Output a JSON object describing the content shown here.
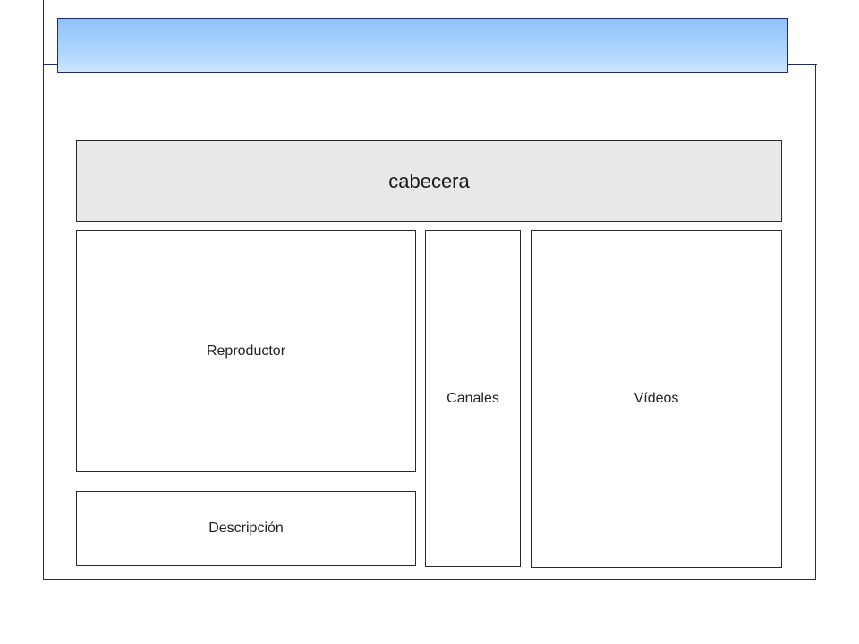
{
  "diagram": {
    "header_label": "cabecera",
    "player_label": "Reproductor",
    "description_label": "Descripción",
    "channels_label": "Canales",
    "videos_label": "Vídeos"
  },
  "colors": {
    "frame_border": "#1f2a6b",
    "title_bar_gradient_top": "#8ec2fb",
    "title_bar_gradient_bottom": "#cfe6fe",
    "header_fill": "#e8e8e8",
    "box_border": "#2a2a2a"
  }
}
